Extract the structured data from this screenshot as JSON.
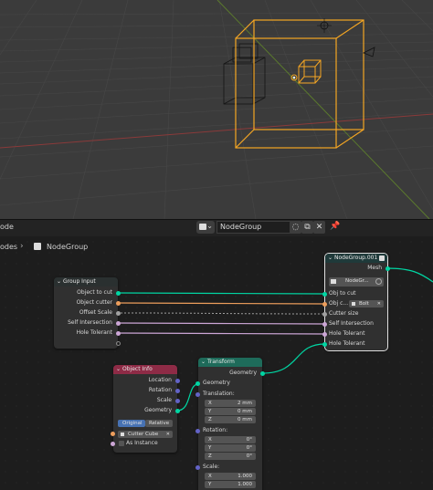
{
  "header": {
    "editor_label": "ode",
    "nodegroup_name": "NodeGroup",
    "shield_icon": "shield-icon",
    "copy_icon": "copy-icon",
    "close_icon": "close-icon",
    "pin_icon": "pin-icon"
  },
  "breadcrumb": {
    "first": "odes",
    "second": "NodeGroup"
  },
  "nodes": {
    "group_input": {
      "title": "Group Input",
      "outputs": [
        "Object to cut",
        "Object cutter",
        "Offset Scale",
        "Self Intersection",
        "Hole Tolerant"
      ]
    },
    "nodegroup001": {
      "title": "NodeGroup.001",
      "output": "Mesh",
      "group_field": "NodeGr...",
      "obj_label": "Obj c...",
      "obj_value": "Bolt",
      "inputs": [
        "Obj to cut",
        "Cutter size",
        "Self Intersection",
        "Hole Tolerant",
        "Hole Tolerant"
      ]
    },
    "object_info": {
      "title": "Object Info",
      "outputs": [
        "Location",
        "Rotation",
        "Scale",
        "Geometry"
      ],
      "mode_original": "Original",
      "mode_relative": "Relative",
      "object_value": "Cutter Cube",
      "as_instance": "As Instance"
    },
    "transform": {
      "title": "Transform",
      "output": "Geometry",
      "input_geometry": "Geometry",
      "translation_label": "Translation:",
      "translation": [
        {
          "axis": "X",
          "value": "2 mm"
        },
        {
          "axis": "Y",
          "value": "0 mm"
        },
        {
          "axis": "Z",
          "value": "0 mm"
        }
      ],
      "rotation_label": "Rotation:",
      "rotation": [
        {
          "axis": "X",
          "value": "0°"
        },
        {
          "axis": "Y",
          "value": "0°"
        },
        {
          "axis": "Z",
          "value": "0°"
        }
      ],
      "scale_label": "Scale:",
      "scale": [
        {
          "axis": "X",
          "value": "1.000"
        },
        {
          "axis": "Y",
          "value": "1.000"
        }
      ]
    }
  },
  "colors": {
    "geometry_socket": "#00d6a3",
    "object_socket": "#ed9e5c",
    "float_socket": "#a1a1a1",
    "bool_socket": "#cca6d6",
    "vector_socket": "#6363c7",
    "selection_orange": "#f5a623",
    "object_info_header": "#8e2b46",
    "transform_header": "#1e6b5a",
    "group_header": "#1f3a3a"
  }
}
